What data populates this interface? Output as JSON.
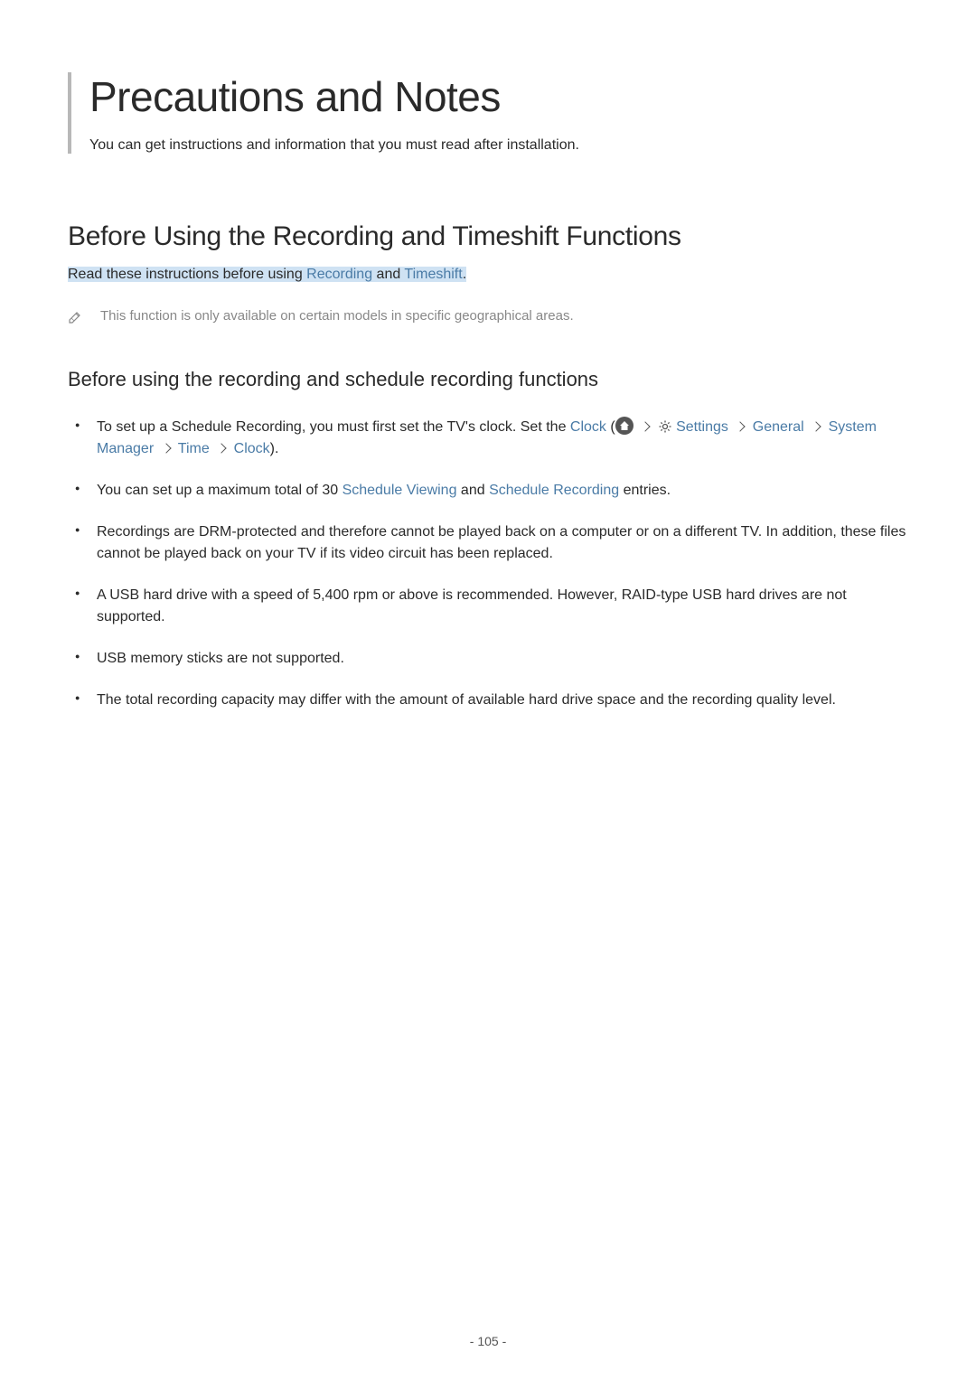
{
  "title": "Precautions and Notes",
  "subtitle": "You can get instructions and information that you must read after installation.",
  "section": {
    "title": "Before Using the Recording and Timeshift Functions",
    "intro_pre": "Read these instructions before using ",
    "intro_link1": "Recording",
    "intro_mid": " and ",
    "intro_link2": "Timeshift",
    "intro_post": "."
  },
  "note": "This function is only available on certain models in specific geographical areas.",
  "subsection": {
    "title": "Before using the recording and schedule recording functions"
  },
  "bullets": {
    "b1_pre": "To set up a Schedule Recording, you must first set the TV's clock. Set the ",
    "b1_clock": "Clock",
    "b1_open": " (",
    "b1_settings": "Settings",
    "b1_general": "General",
    "b1_system_manager": "System Manager",
    "b1_time": "Time",
    "b1_clock2": "Clock",
    "b1_close": ").",
    "b2_pre": "You can set up a maximum total of 30 ",
    "b2_sv": "Schedule Viewing",
    "b2_mid": " and ",
    "b2_sr": "Schedule Recording",
    "b2_post": " entries.",
    "b3": "Recordings are DRM-protected and therefore cannot be played back on a computer or on a different TV. In addition, these files cannot be played back on your TV if its video circuit has been replaced.",
    "b4": "A USB hard drive with a speed of 5,400 rpm or above is recommended. However, RAID-type USB hard drives are not supported.",
    "b5": "USB memory sticks are not supported.",
    "b6": "The total recording capacity may differ with the amount of available hard drive space and the recording quality level."
  },
  "page_number": "- 105 -"
}
